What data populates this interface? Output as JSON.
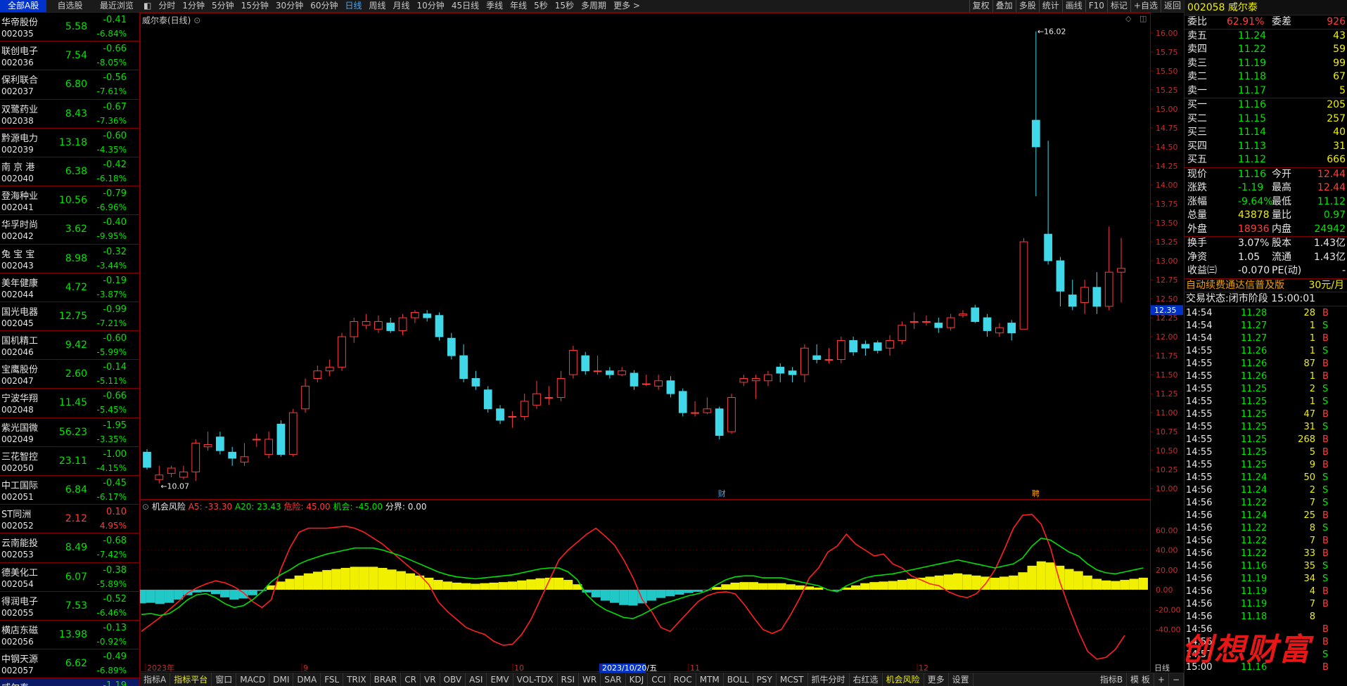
{
  "left_tabs": [
    "全部A股",
    "自选股",
    "最近浏览"
  ],
  "stocks": [
    {
      "name": "华帝股份",
      "code": "002035",
      "price": "5.58",
      "chg": "-0.41",
      "pct": "-6.84%"
    },
    {
      "name": "联创电子",
      "code": "002036",
      "price": "7.54",
      "chg": "-0.66",
      "pct": "-8.05%"
    },
    {
      "name": "保利联合",
      "code": "002037",
      "price": "6.80",
      "chg": "-0.56",
      "pct": "-7.61%"
    },
    {
      "name": "双鹭药业",
      "code": "002038",
      "price": "8.43",
      "chg": "-0.67",
      "pct": "-7.36%"
    },
    {
      "name": "黔源电力",
      "code": "002039",
      "price": "13.18",
      "chg": "-0.60",
      "pct": "-4.35%"
    },
    {
      "name": "南 京 港",
      "code": "002040",
      "price": "6.38",
      "chg": "-0.42",
      "pct": "-6.18%"
    },
    {
      "name": "登海种业",
      "code": "002041",
      "price": "10.56",
      "chg": "-0.79",
      "pct": "-6.96%"
    },
    {
      "name": "华孚时尚",
      "code": "002042",
      "price": "3.62",
      "chg": "-0.40",
      "pct": "-9.95%"
    },
    {
      "name": "兔 宝 宝",
      "code": "002043",
      "price": "8.98",
      "chg": "-0.32",
      "pct": "-3.44%"
    },
    {
      "name": "美年健康",
      "code": "002044",
      "price": "4.72",
      "chg": "-0.19",
      "pct": "-3.87%"
    },
    {
      "name": "国光电器",
      "code": "002045",
      "price": "12.75",
      "chg": "-0.99",
      "pct": "-7.21%"
    },
    {
      "name": "国机精工",
      "code": "002046",
      "price": "9.42",
      "chg": "-0.60",
      "pct": "-5.99%"
    },
    {
      "name": "宝鹰股份",
      "code": "002047",
      "price": "2.60",
      "chg": "-0.14",
      "pct": "-5.11%"
    },
    {
      "name": "宁波华翔",
      "code": "002048",
      "price": "11.45",
      "chg": "-0.66",
      "pct": "-5.45%"
    },
    {
      "name": "紫光国微",
      "code": "002049",
      "price": "56.23",
      "chg": "-1.95",
      "pct": "-3.35%"
    },
    {
      "name": "三花智控",
      "code": "002050",
      "price": "23.11",
      "chg": "-1.00",
      "pct": "-4.15%"
    },
    {
      "name": "中工国际",
      "code": "002051",
      "price": "6.84",
      "chg": "-0.45",
      "pct": "-6.17%"
    },
    {
      "name": "ST同洲",
      "code": "002052",
      "price": "2.12",
      "chg": "0.10",
      "pct": "4.95%",
      "up": true
    },
    {
      "name": "云南能投",
      "code": "002053",
      "price": "8.49",
      "chg": "-0.68",
      "pct": "-7.42%"
    },
    {
      "name": "德美化工",
      "code": "002054",
      "price": "6.07",
      "chg": "-0.38",
      "pct": "-5.89%"
    },
    {
      "name": "得润电子",
      "code": "002055",
      "price": "7.53",
      "chg": "-0.52",
      "pct": "-6.46%"
    },
    {
      "name": "横店东磁",
      "code": "002056",
      "price": "13.98",
      "chg": "-0.13",
      "pct": "-0.92%"
    },
    {
      "name": "中钢天源",
      "code": "002057",
      "price": "6.62",
      "chg": "-0.49",
      "pct": "-6.89%"
    },
    {
      "name": "威尔泰",
      "code": "",
      "price": "",
      "chg": "-1.19",
      "pct": "",
      "sel": true
    }
  ],
  "toolbar": {
    "periods": [
      "分时",
      "1分钟",
      "5分钟",
      "15分钟",
      "30分钟",
      "60分钟",
      "日线",
      "周线",
      "月线",
      "10分钟",
      "45日线",
      "季线",
      "年线",
      "5秒",
      "15秒",
      "多周期",
      "更多 >"
    ],
    "active": "日线",
    "right": [
      "复权",
      "叠加",
      "多股",
      "统计",
      "画线",
      "F10",
      "标记",
      "+自选",
      "返回"
    ]
  },
  "chart": {
    "title": "威尔泰(日线)",
    "high_label": "16.02",
    "low_label": "10.07",
    "marker_cai": "财",
    "marker_shen": "聘",
    "cur_price_tag": "12.35",
    "yticks": [
      "16.00",
      "15.75",
      "15.50",
      "15.25",
      "15.00",
      "14.75",
      "14.50",
      "14.25",
      "14.00",
      "13.75",
      "13.50",
      "13.25",
      "13.00",
      "12.75",
      "12.50",
      "12.25",
      "12.00",
      "11.75",
      "11.50",
      "11.25",
      "11.00",
      "10.75",
      "10.50",
      "10.25",
      "10.00"
    ],
    "ind_yticks": [
      "60.00",
      "40.00",
      "20.00",
      "0.00",
      "-20.00",
      "-40.00"
    ],
    "dates": [
      "2023年",
      "9",
      "10",
      "2023/10/20/五",
      "11",
      "12"
    ],
    "date_tag": "日线"
  },
  "indicator": {
    "name": "机会风险",
    "a5": "A5: -33.30",
    "a20": "A20: 23.43",
    "danger": "危险: 45.00",
    "chance": "机会: -45.00",
    "boundary": "分界: 0.00"
  },
  "bottom_tabs": [
    "指标A",
    "指标平台",
    "窗口",
    "MACD",
    "DMI",
    "DMA",
    "FSL",
    "TRIX",
    "BRAR",
    "CR",
    "VR",
    "OBV",
    "ASI",
    "EMV",
    "VOL-TDX",
    "RSI",
    "WR",
    "SAR",
    "KDJ",
    "CCI",
    "ROC",
    "MTM",
    "BOLL",
    "PSY",
    "MCST",
    "抓牛分时",
    "右红选",
    "机会风险",
    "更多",
    "设置"
  ],
  "bottom_active": [
    "指标平台",
    "机会风险"
  ],
  "bottom_right": [
    "指标B",
    "模 板",
    "+",
    "−"
  ],
  "quote": {
    "code": "002058",
    "name": "威尔泰",
    "weibi": {
      "label": "委比",
      "val": "62.91%",
      "label2": "委差",
      "val2": "926"
    },
    "sells": [
      {
        "l": "卖五",
        "p": "11.24",
        "v": "43"
      },
      {
        "l": "卖四",
        "p": "11.22",
        "v": "59"
      },
      {
        "l": "卖三",
        "p": "11.19",
        "v": "99"
      },
      {
        "l": "卖二",
        "p": "11.18",
        "v": "67"
      },
      {
        "l": "卖一",
        "p": "11.17",
        "v": "5"
      }
    ],
    "buys": [
      {
        "l": "买一",
        "p": "11.16",
        "v": "205"
      },
      {
        "l": "买二",
        "p": "11.15",
        "v": "257"
      },
      {
        "l": "买三",
        "p": "11.14",
        "v": "40"
      },
      {
        "l": "买四",
        "p": "11.13",
        "v": "31"
      },
      {
        "l": "买五",
        "p": "11.12",
        "v": "666"
      }
    ],
    "stats": [
      {
        "l": "现价",
        "v": "11.16",
        "l2": "今开",
        "v2": "12.44"
      },
      {
        "l": "涨跌",
        "v": "-1.19",
        "l2": "最高",
        "v2": "12.44"
      },
      {
        "l": "涨幅",
        "v": "-9.64%",
        "l2": "最低",
        "v2": "11.12"
      },
      {
        "l": "总量",
        "v": "43878",
        "l2": "量比",
        "v2": "0.97"
      },
      {
        "l": "外盘",
        "v": "18936",
        "l2": "内盘",
        "v2": "24942"
      }
    ],
    "stats2": [
      {
        "l": "换手",
        "v": "3.07%",
        "l2": "股本",
        "v2": "1.43亿"
      },
      {
        "l": "净资",
        "v": "1.05",
        "l2": "流通",
        "v2": "1.43亿"
      },
      {
        "l": "收益㈢",
        "v": "-0.070",
        "l2": "PE(动)",
        "v2": "-"
      }
    ],
    "promo": "自动续费通达信普及版",
    "promo_price": "30元/月",
    "status": "交易状态:闭市阶段 15:00:01"
  },
  "ticks": [
    [
      "14:54",
      "11.28",
      "28",
      "B"
    ],
    [
      "14:54",
      "11.27",
      "1",
      "S"
    ],
    [
      "14:54",
      "11.27",
      "1",
      "B"
    ],
    [
      "14:55",
      "11.26",
      "1",
      "S"
    ],
    [
      "14:55",
      "11.26",
      "87",
      "B"
    ],
    [
      "14:55",
      "11.26",
      "1",
      "B"
    ],
    [
      "14:55",
      "11.25",
      "2",
      "S"
    ],
    [
      "14:55",
      "11.25",
      "1",
      "S"
    ],
    [
      "14:55",
      "11.25",
      "47",
      "B"
    ],
    [
      "14:55",
      "11.25",
      "31",
      "S"
    ],
    [
      "14:55",
      "11.25",
      "268",
      "B"
    ],
    [
      "14:55",
      "11.25",
      "5",
      "B"
    ],
    [
      "14:55",
      "11.25",
      "9",
      "B"
    ],
    [
      "14:55",
      "11.24",
      "50",
      "S"
    ],
    [
      "14:56",
      "11.24",
      "2",
      "S"
    ],
    [
      "14:56",
      "11.22",
      "7",
      "S"
    ],
    [
      "14:56",
      "11.24",
      "25",
      "B"
    ],
    [
      "14:56",
      "11.22",
      "8",
      "S"
    ],
    [
      "14:56",
      "11.22",
      "7",
      "B"
    ],
    [
      "14:56",
      "11.22",
      "33",
      "B"
    ],
    [
      "14:56",
      "11.16",
      "35",
      "S"
    ],
    [
      "14:56",
      "11.19",
      "34",
      "S"
    ],
    [
      "14:56",
      "11.19",
      "4",
      "B"
    ],
    [
      "14:56",
      "11.19",
      "7",
      "B"
    ],
    [
      "14:56",
      "11.18",
      "8",
      ""
    ],
    [
      "14:56",
      "",
      "",
      "B"
    ],
    [
      "14:56",
      "",
      "",
      "B"
    ],
    [
      "14:57",
      "",
      "",
      "S"
    ],
    [
      "15:00",
      "11.16",
      "",
      "B"
    ]
  ],
  "watermark": "创想财富",
  "candles": [
    [
      10.48,
      10.28,
      10.52,
      10.25
    ],
    [
      10.12,
      10.18,
      10.3,
      10.07
    ],
    [
      10.2,
      10.27,
      10.3,
      10.15
    ],
    [
      10.15,
      10.22,
      10.3,
      10.12
    ],
    [
      10.22,
      10.6,
      10.65,
      10.1
    ],
    [
      10.55,
      10.58,
      10.75,
      10.5
    ],
    [
      10.68,
      10.5,
      10.75,
      10.45
    ],
    [
      10.48,
      10.4,
      10.55,
      10.3
    ],
    [
      10.35,
      10.42,
      10.6,
      10.3
    ],
    [
      10.65,
      10.65,
      10.72,
      10.55
    ],
    [
      10.45,
      10.65,
      10.75,
      10.4
    ],
    [
      10.85,
      10.45,
      10.9,
      10.42
    ],
    [
      10.45,
      11.0,
      11.05,
      10.42
    ],
    [
      11.05,
      11.35,
      11.45,
      11.0
    ],
    [
      11.45,
      11.55,
      11.62,
      11.4
    ],
    [
      11.55,
      11.6,
      11.7,
      11.48
    ],
    [
      11.6,
      12.0,
      12.05,
      11.55
    ],
    [
      12.0,
      12.2,
      12.25,
      11.92
    ],
    [
      12.15,
      12.2,
      12.3,
      12.1
    ],
    [
      12.1,
      12.2,
      12.28,
      12.05
    ],
    [
      12.18,
      12.08,
      12.25,
      12.05
    ],
    [
      12.08,
      12.25,
      12.3,
      12.02
    ],
    [
      12.25,
      12.32,
      12.35,
      12.18
    ],
    [
      12.3,
      12.25,
      12.35,
      12.2
    ],
    [
      12.28,
      12.0,
      12.32,
      11.95
    ],
    [
      11.98,
      11.75,
      12.05,
      11.7
    ],
    [
      11.75,
      11.45,
      11.9,
      11.4
    ],
    [
      11.45,
      11.35,
      11.55,
      11.3
    ],
    [
      11.3,
      11.05,
      11.35,
      11.0
    ],
    [
      11.05,
      10.9,
      11.1,
      10.85
    ],
    [
      10.95,
      10.95,
      11.02,
      10.8
    ],
    [
      10.95,
      11.15,
      11.25,
      10.9
    ],
    [
      11.1,
      11.25,
      11.42,
      11.05
    ],
    [
      11.2,
      11.2,
      11.35,
      11.1
    ],
    [
      11.2,
      11.45,
      11.55,
      11.15
    ],
    [
      11.5,
      11.82,
      11.88,
      11.45
    ],
    [
      11.75,
      11.55,
      11.8,
      11.5
    ],
    [
      11.55,
      11.55,
      11.75,
      11.5
    ],
    [
      11.55,
      11.5,
      11.6,
      11.45
    ],
    [
      11.5,
      11.55,
      11.6,
      11.48
    ],
    [
      11.52,
      11.35,
      11.56,
      11.3
    ],
    [
      11.38,
      11.38,
      11.5,
      11.35
    ],
    [
      11.35,
      11.42,
      11.5,
      11.3
    ],
    [
      11.42,
      11.25,
      11.48,
      11.2
    ],
    [
      11.28,
      11.0,
      11.32,
      10.95
    ],
    [
      11.0,
      11.0,
      11.15,
      10.95
    ],
    [
      11.0,
      11.05,
      11.2,
      10.98
    ],
    [
      11.05,
      10.7,
      11.08,
      10.65
    ],
    [
      10.75,
      11.2,
      11.25,
      10.72
    ],
    [
      11.4,
      11.45,
      11.5,
      11.35
    ],
    [
      11.42,
      11.45,
      11.5,
      11.18
    ],
    [
      11.42,
      11.5,
      11.55,
      11.35
    ],
    [
      11.6,
      11.52,
      11.65,
      11.4
    ],
    [
      11.55,
      11.5,
      11.6,
      11.4
    ],
    [
      11.5,
      11.85,
      11.9,
      11.4
    ],
    [
      11.75,
      11.7,
      11.9,
      11.65
    ],
    [
      11.7,
      11.7,
      11.85,
      11.65
    ],
    [
      11.7,
      11.95,
      12.0,
      11.65
    ],
    [
      11.95,
      11.8,
      12.0,
      11.75
    ],
    [
      11.9,
      11.85,
      11.95,
      11.75
    ],
    [
      11.92,
      11.82,
      11.95,
      11.78
    ],
    [
      11.85,
      11.95,
      12.02,
      11.75
    ],
    [
      11.95,
      12.15,
      12.2,
      11.9
    ],
    [
      12.2,
      12.2,
      12.32,
      12.1
    ],
    [
      12.2,
      12.2,
      12.28,
      12.15
    ],
    [
      12.18,
      12.12,
      12.25,
      12.05
    ],
    [
      12.12,
      12.25,
      12.3,
      12.08
    ],
    [
      12.28,
      12.3,
      12.35,
      12.25
    ],
    [
      12.38,
      12.2,
      12.42,
      12.18
    ],
    [
      12.25,
      12.08,
      12.3,
      12.0
    ],
    [
      12.05,
      12.12,
      12.18,
      12.0
    ],
    [
      12.18,
      12.05,
      12.22,
      11.95
    ],
    [
      12.1,
      13.25,
      13.3,
      12.1
    ],
    [
      14.85,
      14.5,
      16.02,
      13.85
    ],
    [
      13.35,
      13.0,
      14.58,
      12.95
    ],
    [
      13.0,
      12.6,
      13.05,
      12.4
    ],
    [
      12.55,
      12.4,
      12.75,
      12.35
    ],
    [
      12.45,
      12.65,
      12.75,
      12.3
    ],
    [
      12.65,
      12.4,
      12.85,
      12.3
    ],
    [
      12.4,
      12.85,
      13.45,
      12.35
    ],
    [
      12.85,
      12.9,
      13.3,
      12.45
    ]
  ],
  "ind": {
    "red": [
      -42,
      -35,
      -28,
      -20,
      -12,
      -3,
      2,
      6,
      9,
      7,
      3,
      -3,
      -12,
      -18,
      -10,
      20,
      42,
      58,
      62,
      62,
      62,
      63,
      64,
      62,
      58,
      52,
      46,
      38,
      30,
      22,
      15,
      5,
      -12,
      -22,
      -30,
      -38,
      -42,
      -45,
      -52,
      -56,
      -55,
      -45,
      -30,
      -10,
      10,
      30,
      40,
      48,
      56,
      62,
      54,
      45,
      30,
      12,
      -10,
      -22,
      -38,
      -42,
      -32,
      -22,
      -12,
      -6,
      -3,
      -2,
      -4,
      -15,
      -28,
      -40,
      -44,
      -40,
      -25,
      -8,
      12,
      22,
      38,
      44,
      56,
      46,
      40,
      34,
      36,
      26,
      22,
      14,
      10,
      6,
      4,
      -2,
      -6,
      -8,
      -4,
      6,
      20,
      40,
      62,
      75,
      76,
      66,
      42,
      8,
      -18,
      -42,
      -62,
      -70,
      -68,
      -60,
      -46
    ],
    "green": [
      -25,
      -24,
      -26,
      -24,
      -18,
      -10,
      -5,
      -4,
      -8,
      -14,
      -18,
      -16,
      -10,
      -2,
      8,
      15,
      20,
      26,
      30,
      33,
      36,
      38,
      40,
      42,
      42,
      42,
      40,
      37,
      34,
      30,
      26,
      22,
      18,
      15,
      13,
      12,
      11,
      12,
      13,
      14,
      15,
      17,
      19,
      21,
      22,
      22,
      18,
      10,
      -5,
      -14,
      -20,
      -24,
      -28,
      -29,
      -25,
      -20,
      -15,
      -12,
      -9,
      -6,
      -4,
      -1,
      5,
      10,
      13,
      14,
      14,
      12,
      12,
      12,
      10,
      8,
      6,
      4,
      0,
      -2,
      4,
      8,
      12,
      14,
      15,
      16,
      18,
      20,
      22,
      24,
      26,
      28,
      30,
      28,
      26,
      24,
      22,
      24,
      26,
      32,
      44,
      52,
      50,
      44,
      38,
      34,
      26,
      20,
      17,
      16,
      18,
      20,
      22
    ]
  }
}
